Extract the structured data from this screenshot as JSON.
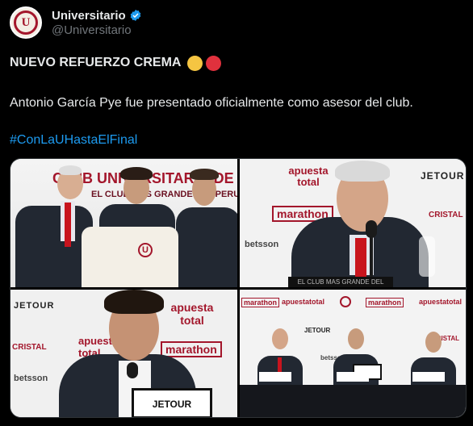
{
  "account": {
    "display_name": "Universitario",
    "handle": "@Universitario",
    "avatar_letter": "U"
  },
  "tweet": {
    "headline": "NUEVO REFUERZO CREMA",
    "emoji_colors": [
      "#f5c542",
      "#e0313d"
    ],
    "body": "Antonio García Pye fue presentado oficialmente como asesor del club.",
    "hashtag": "#ConLaUHastaElFinal"
  },
  "media": {
    "photo1": {
      "banner_top": "CLUB UNIVERSITARIO DE DEP",
      "banner_sub": "EL CLUB MAS GRANDE DEL PERU",
      "shirt_logo": "U"
    },
    "photo2": {
      "sponsor1": "apuesta total",
      "sponsor2": "marathon",
      "sponsor3": "JETOUR",
      "sponsor4": "CRISTAL",
      "sponsor5": "betsson",
      "footer": "EL CLUB MAS GRANDE DEL PERU"
    },
    "photo3": {
      "sponsor1": "apuesta total",
      "sponsor2": "marathon",
      "sponsor3": "JETOUR",
      "sponsor4": "CRISTAL",
      "sponsor5": "betsson",
      "podium": "JETOUR"
    },
    "photo4": {
      "sponsor1": "apuestatotal",
      "sponsor2": "marathon",
      "sponsor3": "JETOUR",
      "sponsor4": "CRISTAL",
      "sponsor5": "betsson"
    }
  },
  "colors": {
    "accent_blue": "#1d9bf0",
    "club_red": "#a3162b"
  }
}
